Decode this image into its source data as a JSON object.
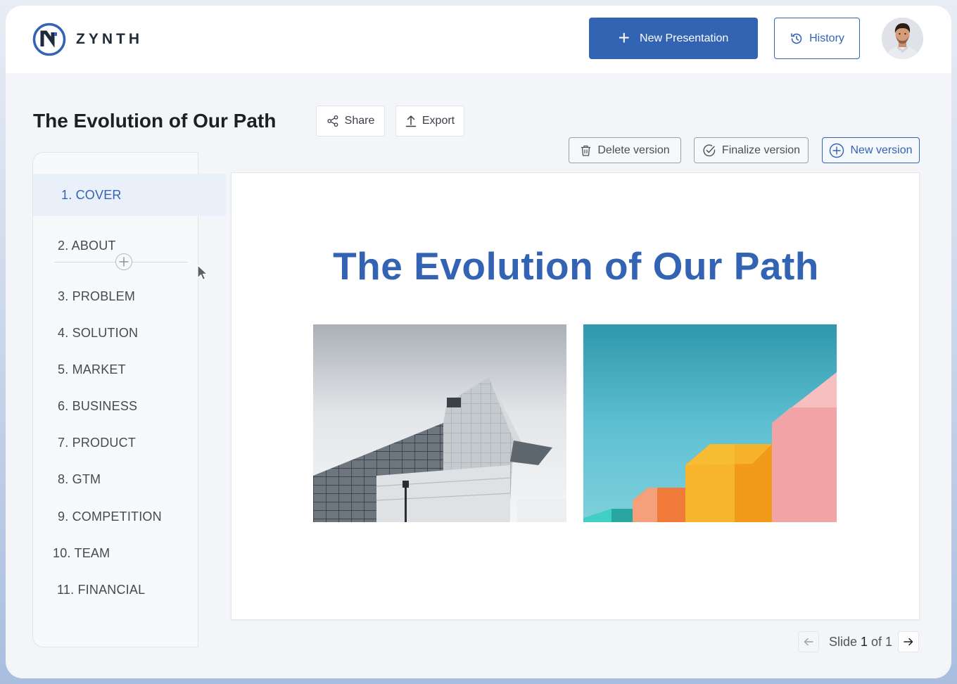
{
  "brand": {
    "name": "ZYNTH",
    "accent": "#3363b3"
  },
  "header": {
    "new_presentation_label": "New Presentation",
    "history_label": "History"
  },
  "document": {
    "title": "The Evolution of Our Path",
    "share_label": "Share",
    "export_label": "Export"
  },
  "version_actions": {
    "delete_label": "Delete version",
    "finalize_label": "Finalize version",
    "new_label": "New version"
  },
  "sidebar": {
    "items": [
      {
        "label": "1. COVER",
        "active": true
      },
      {
        "label": "2. ABOUT"
      },
      {
        "label": "3. PROBLEM"
      },
      {
        "label": "4. SOLUTION"
      },
      {
        "label": "5. MARKET"
      },
      {
        "label": "6. BUSINESS"
      },
      {
        "label": "7. PRODUCT"
      },
      {
        "label": "8. GTM"
      },
      {
        "label": "9. COMPETITION"
      },
      {
        "label": "10. TEAM"
      },
      {
        "label": "11. FINANCIAL"
      }
    ]
  },
  "slide": {
    "title": "The Evolution of Our Path"
  },
  "pager": {
    "prefix": "Slide ",
    "current": "1",
    "suffix": " of 1"
  }
}
